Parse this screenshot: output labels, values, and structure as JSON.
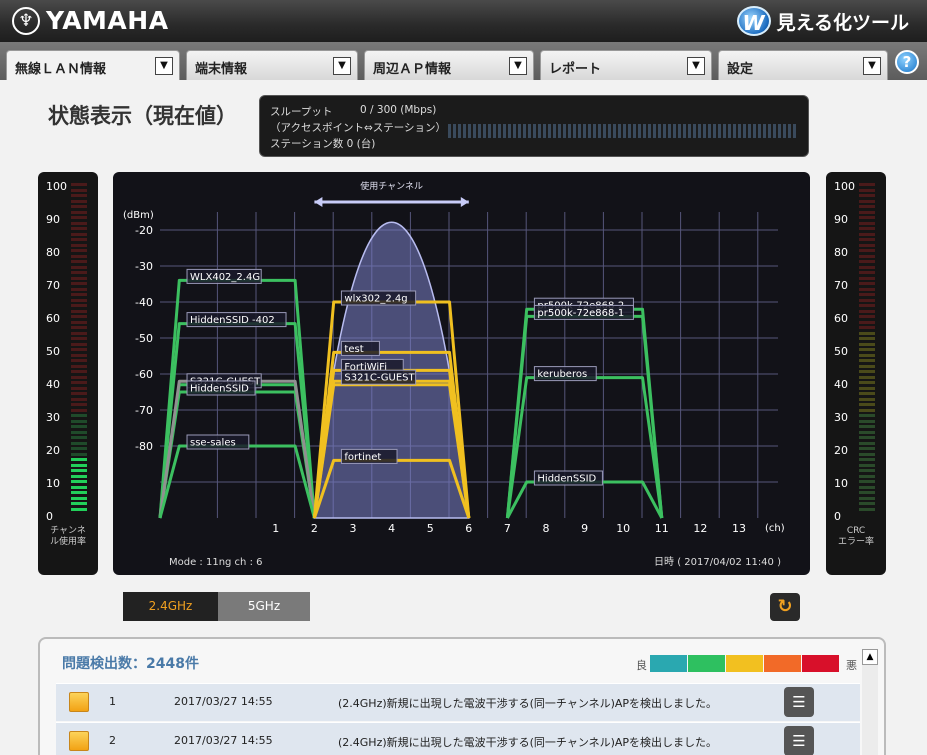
{
  "header": {
    "brand": "YAMAHA",
    "brand_mark": "♆",
    "tool_logo": "W",
    "tool_name": "見える化ツール"
  },
  "tabs": [
    {
      "label": "無線ＬＡＮ情報",
      "dropdown": "▼"
    },
    {
      "label": "端末情報",
      "dropdown": "▼"
    },
    {
      "label": "周辺ＡＰ情報",
      "dropdown": "▼"
    },
    {
      "label": "レポート",
      "dropdown": "▼"
    },
    {
      "label": "設定",
      "dropdown": "▼"
    }
  ],
  "help": "?",
  "page_title": "状態表示（現在値）",
  "status": {
    "throughput_label": "スループット",
    "throughput_value": "0 / 300 (Mbps)",
    "direction": "（アクセスポイント⇔ステーション）",
    "stations": "ステーション数 0 (台)"
  },
  "meters": {
    "ticks": [
      "100",
      "90",
      "80",
      "70",
      "60",
      "50",
      "40",
      "30",
      "20",
      "10",
      "0"
    ],
    "left_caption": [
      "チャンネ",
      "ル使用率"
    ],
    "left_level": 0.16,
    "right_caption": [
      "CRC",
      "エラー率"
    ],
    "right_level": 0
  },
  "chart": {
    "title": "使用チャンネル",
    "y_unit": "(dBm)",
    "y_ticks": [
      "-20",
      "-30",
      "-40",
      "-50",
      "-60",
      "-70",
      "-80"
    ],
    "x_ticks": [
      "1",
      "2",
      "3",
      "4",
      "5",
      "6",
      "7",
      "8",
      "9",
      "10",
      "11",
      "12",
      "13"
    ],
    "x_unit": "(ch)",
    "mode": "Mode : 11ng    ch : 6",
    "datetime": "日時 ( 2017/04/02 11:40 )",
    "used_channel": 6,
    "used_peak_dbm": -21,
    "networks": [
      {
        "ssid": "WLX402_2.4G",
        "channel": 2,
        "rssi": -34,
        "color": "#3cc060"
      },
      {
        "ssid": "HiddenSSID -402",
        "channel": 2,
        "rssi": -46,
        "color": "#3cc060"
      },
      {
        "ssid": "S321C-GUEST",
        "channel": 2,
        "rssi": -63,
        "color": "#3cc060"
      },
      {
        "ssid": "HiddenSSID",
        "channel": 2,
        "rssi": -65,
        "color": "#3cc060"
      },
      {
        "ssid": "",
        "channel": 2,
        "rssi": -62,
        "color": "#909090"
      },
      {
        "ssid": "sse-sales",
        "channel": 2,
        "rssi": -80,
        "color": "#3cc060"
      },
      {
        "ssid": "wlx302_2.4g",
        "channel": 6,
        "rssi": -40,
        "color": "#f0c020"
      },
      {
        "ssid": "test",
        "channel": 6,
        "rssi": -54,
        "color": "#f0c020"
      },
      {
        "ssid": "FortiWiFi",
        "channel": 6,
        "rssi": -59,
        "color": "#f0c020"
      },
      {
        "ssid": "S321C-GUEST",
        "channel": 6,
        "rssi": -62,
        "color": "#f0c020"
      },
      {
        "ssid": "",
        "channel": 6,
        "rssi": -63,
        "color": "#f0c020"
      },
      {
        "ssid": "fortinet",
        "channel": 6,
        "rssi": -84,
        "color": "#f0c020"
      },
      {
        "ssid": "pr500k-72e868-2",
        "channel": 11,
        "rssi": -42,
        "color": "#3cc060"
      },
      {
        "ssid": "pr500k-72e868-1",
        "channel": 11,
        "rssi": -44,
        "color": "#3cc060"
      },
      {
        "ssid": "keruberos",
        "channel": 11,
        "rssi": -61,
        "color": "#3cc060"
      },
      {
        "ssid": "HiddenSSID",
        "channel": 11,
        "rssi": -90,
        "color": "#3cc060"
      }
    ]
  },
  "band": {
    "b24": "2.4GHz",
    "b5": "5GHz",
    "refresh": "↻"
  },
  "issues": {
    "title": "問題検出数：2448件",
    "legend_good": "良",
    "legend_bad": "悪",
    "legend_colors": [
      "#2aa8b0",
      "#2ec060",
      "#f2c020",
      "#f26a28",
      "#d8102a"
    ],
    "scroll_up": "▲",
    "rows": [
      {
        "no": "1",
        "time": "2017/03/27 14:55",
        "message": "(2.4GHz)新規に出現した電波干渉する(同一チャンネル)APを検出しました。",
        "detail": "☰"
      },
      {
        "no": "2",
        "time": "2017/03/27 14:55",
        "message": "(2.4GHz)新規に出現した電波干渉する(同一チャンネル)APを検出しました。",
        "detail": "☰"
      }
    ]
  }
}
